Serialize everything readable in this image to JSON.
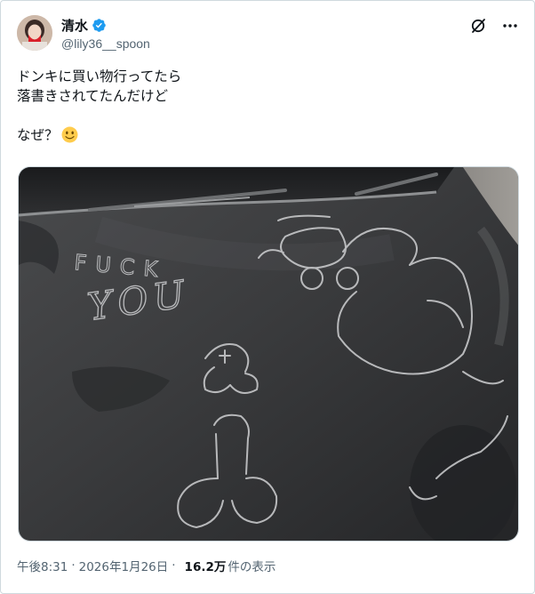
{
  "author": {
    "display_name": "清水",
    "handle": "@lily36__spoon",
    "verified": true
  },
  "header_icons": [
    "grok-icon",
    "more-icon"
  ],
  "tweet": {
    "lines": [
      "ドンキに買い物行ってたら",
      "落書きされてたんだけど",
      "",
      "なぜ？"
    ],
    "emoji": "slightly-smiling-face"
  },
  "media": {
    "scratched_text": [
      "FUCK",
      "YOU"
    ]
  },
  "meta": {
    "time": "午後8:31",
    "separator": "·",
    "date": "2026年1月26日",
    "views_count": "16.2万",
    "views_label": "件の表示"
  },
  "colors": {
    "verified_blue": "#1d9bf0",
    "text_primary": "#0f1419",
    "text_secondary": "#536471",
    "border": "#cfd9de",
    "emoji_yellow": "#ffcc4d"
  }
}
